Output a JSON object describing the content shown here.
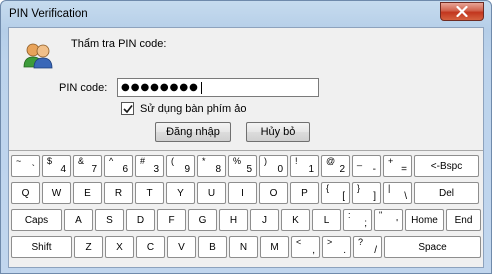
{
  "window": {
    "title": "PIN Verification",
    "header_text": "Thẩm tra PIN code:",
    "pin_label": "PIN code:",
    "pin_value": "●●●●●●●●",
    "virtual_keyboard_label": "Sử dụng bàn phím ảo",
    "virtual_keyboard_checked": true,
    "login_button": "Đăng nhập",
    "cancel_button": "Hủy bỏ"
  },
  "keyboard": {
    "row1": [
      {
        "up": "~",
        "lo": "`"
      },
      {
        "up": "$",
        "lo": "4"
      },
      {
        "up": "&",
        "lo": "7"
      },
      {
        "up": "^",
        "lo": "6"
      },
      {
        "up": "#",
        "lo": "3"
      },
      {
        "up": "(",
        "lo": "9"
      },
      {
        "up": "*",
        "lo": "8"
      },
      {
        "up": "%",
        "lo": "5"
      },
      {
        "up": ")",
        "lo": "0"
      },
      {
        "up": "!",
        "lo": "1"
      },
      {
        "up": "@",
        "lo": "2"
      },
      {
        "up": "_",
        "lo": "-"
      },
      {
        "up": "+",
        "lo": "="
      },
      {
        "label": "<-Bspc"
      }
    ],
    "row2": [
      "Q",
      "W",
      "E",
      "R",
      "T",
      "Y",
      "U",
      "I",
      "O",
      "P",
      {
        "up": "{",
        "lo": "["
      },
      {
        "up": "}",
        "lo": "]"
      },
      {
        "up": "|",
        "lo": "\\"
      },
      "Del"
    ],
    "row3": [
      "Caps",
      "A",
      "S",
      "D",
      "F",
      "G",
      "H",
      "J",
      "K",
      "L",
      {
        "up": ":",
        "lo": ";"
      },
      {
        "up": "\"",
        "lo": "'"
      },
      "Home",
      "End"
    ],
    "row4": [
      "Shift",
      "Z",
      "X",
      "C",
      "V",
      "B",
      "N",
      "M",
      {
        "up": "<",
        "lo": ","
      },
      {
        "up": ">",
        "lo": "."
      },
      {
        "up": "?",
        "lo": "/"
      },
      "Space"
    ]
  }
}
